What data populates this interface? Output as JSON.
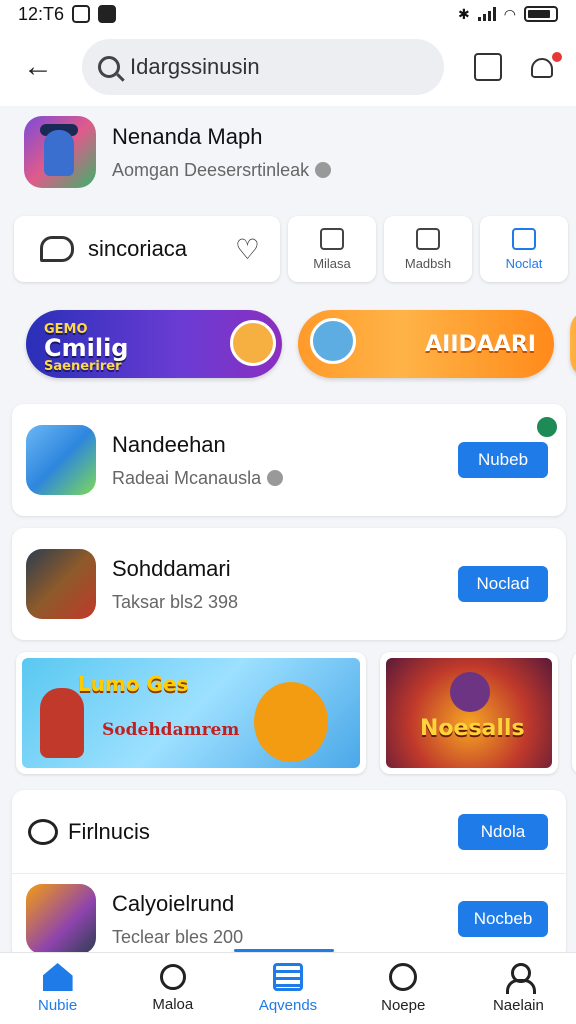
{
  "status_bar": {
    "time": "12:T6"
  },
  "search": {
    "value": "Idargssinusin"
  },
  "app": {
    "title": "Nenanda Maph",
    "subtitle": "Aomgan Deesersrtinleak"
  },
  "toolbar": {
    "main_label": "sincoriaca",
    "buttons": [
      {
        "label": "Milasa",
        "active": false
      },
      {
        "label": "Madbsh",
        "active": false
      },
      {
        "label": "Noclat",
        "active": true
      }
    ]
  },
  "banners": [
    {
      "text_line1": "GEMO",
      "text_line2": "Cmilig",
      "text_line3": "Saenerirer"
    },
    {
      "text": "AIIDAARI"
    }
  ],
  "rows": [
    {
      "title": "Nandeehan",
      "subtitle": "Radeai Mcanausla",
      "button": "Nubeb"
    },
    {
      "title": "Sohddamari",
      "subtitle": "Taksar bls2 398",
      "button": "Noclad"
    }
  ],
  "promos": [
    {
      "title": "Lumo Ges",
      "subtitle": "Sodehdamrem"
    },
    {
      "title": "Noesalls"
    }
  ],
  "section": {
    "title": "Firlnucis",
    "button": "Ndola",
    "row": {
      "title": "Calyoielrund",
      "subtitle": "Teclear bles 200",
      "button": "Nocbeb"
    }
  },
  "bottom_nav": [
    {
      "label": "Nubie",
      "icon": "home-icon",
      "active": true
    },
    {
      "label": "Maloa",
      "icon": "search-icon",
      "active": false
    },
    {
      "label": "Aqvends",
      "icon": "list-icon",
      "active": true
    },
    {
      "label": "Noepe",
      "icon": "compass-icon",
      "active": false
    },
    {
      "label": "Naelain",
      "icon": "user-icon",
      "active": false
    }
  ],
  "colors": {
    "accent": "#1f7be8",
    "notification": "#e53935",
    "badge": "#1e8a55"
  }
}
